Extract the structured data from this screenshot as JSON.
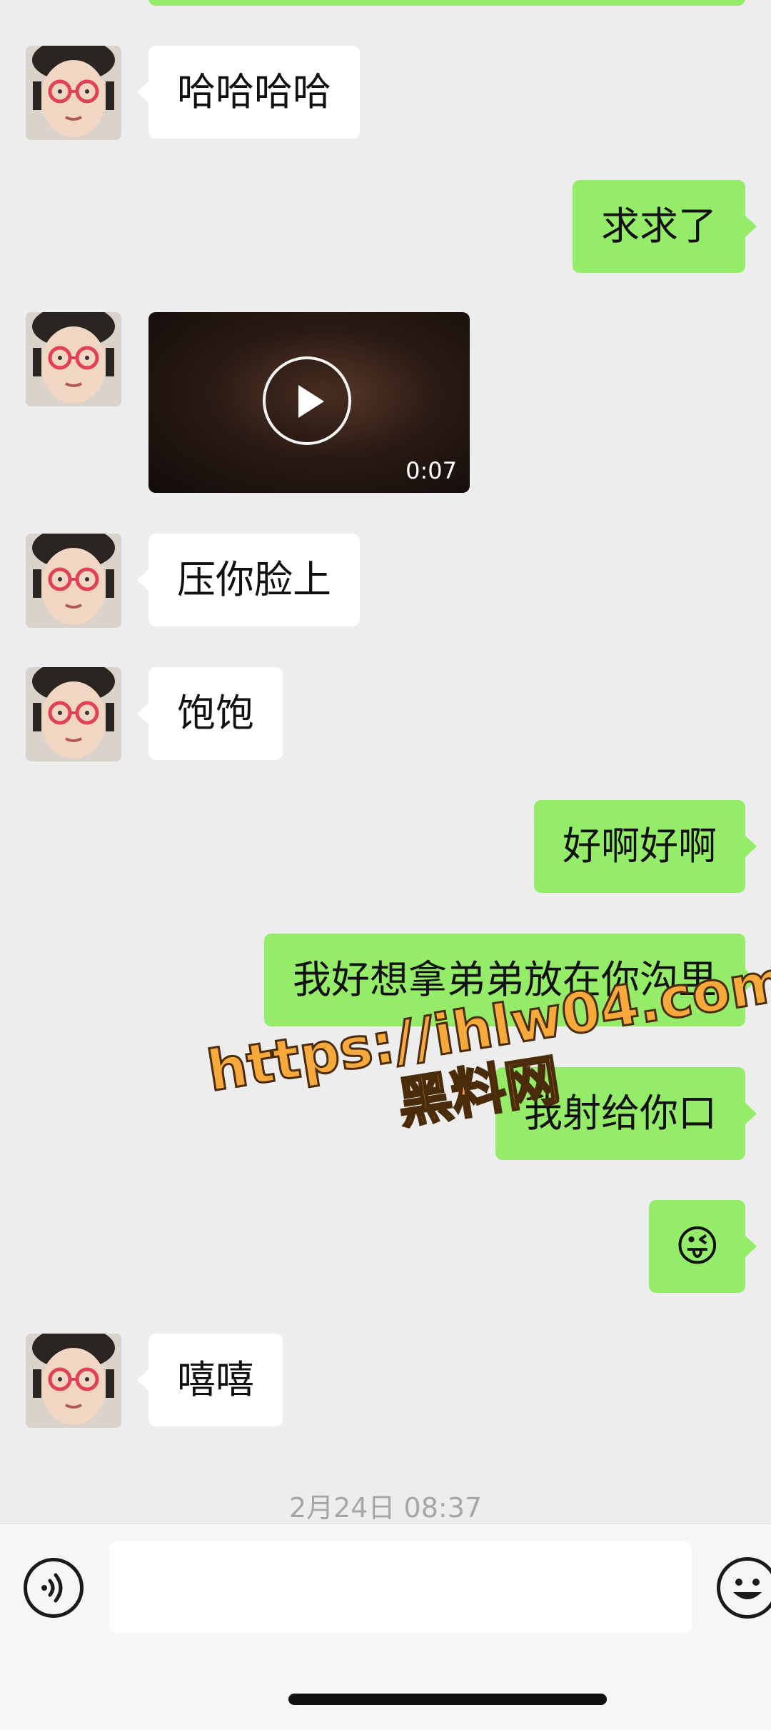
{
  "messages": [
    {
      "side": "in",
      "text": "哈哈哈哈"
    },
    {
      "side": "out",
      "text": "求求了"
    },
    {
      "side": "in",
      "type": "video",
      "duration": "0:07"
    },
    {
      "side": "in",
      "text": "压你脸上"
    },
    {
      "side": "in",
      "text": "饱饱"
    },
    {
      "side": "out",
      "text": "好啊好啊"
    },
    {
      "side": "out",
      "text": "我好想拿弟弟放在你沟里"
    },
    {
      "side": "out",
      "text": "我射给你口"
    },
    {
      "side": "out",
      "type": "emoji",
      "emoji": "😜"
    },
    {
      "side": "in",
      "text": "嘻嘻"
    }
  ],
  "timestamp": "2月24日 08:37",
  "watermark": {
    "url": "https://ihlw04.com",
    "name": "黑料网"
  },
  "input_bar": {
    "voice_icon": "voice-icon",
    "emoji_icon": "emoji-icon",
    "input_value": ""
  },
  "colors": {
    "background": "#ededed",
    "incoming_bubble": "#ffffff",
    "outgoing_bubble": "#95ec69"
  }
}
